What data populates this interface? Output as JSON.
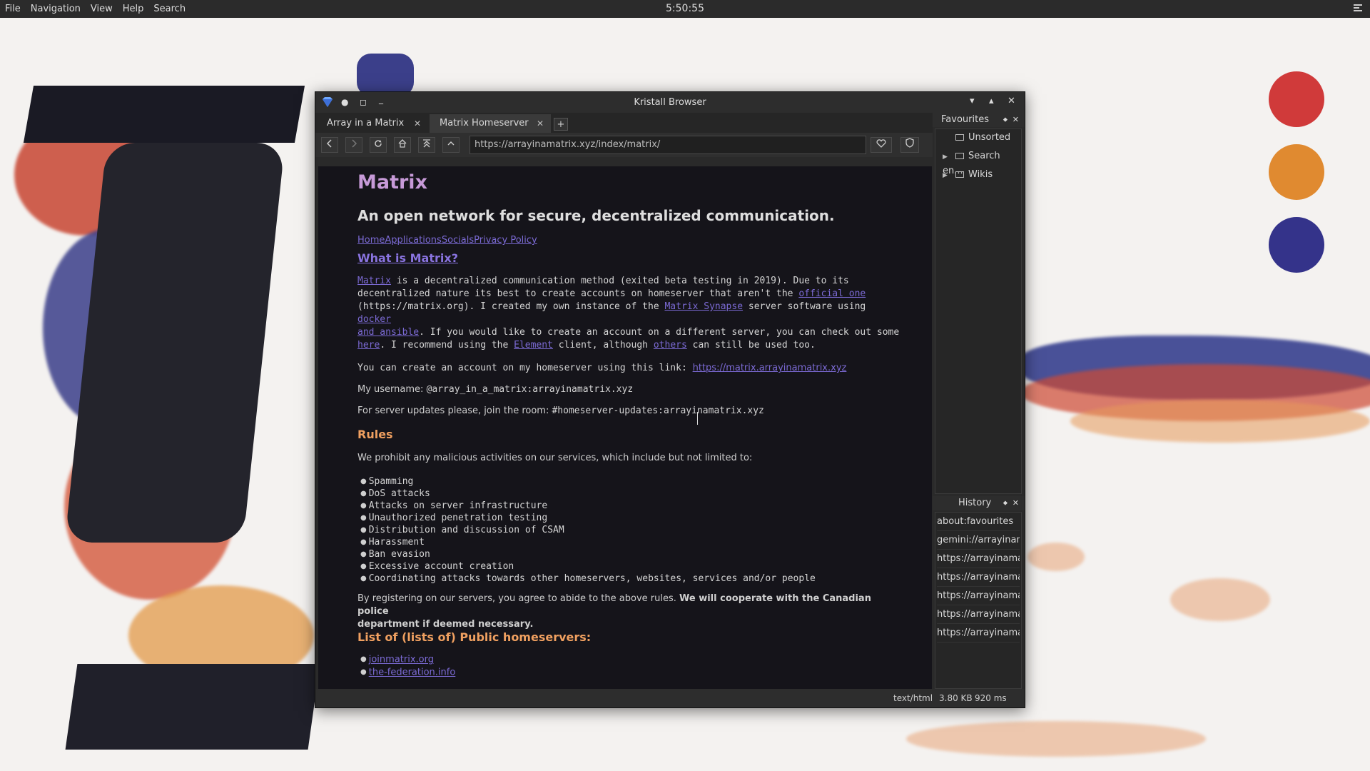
{
  "panel": {
    "menu": [
      "File",
      "Navigation",
      "View",
      "Help",
      "Search"
    ],
    "clock": "5:50:55"
  },
  "window": {
    "title": "Kristall Browser",
    "tabs": [
      {
        "label": "Array in a Matrix",
        "close": "✕"
      },
      {
        "label": "Matrix Homeserver",
        "close": "✕"
      }
    ],
    "newtab": "+",
    "url": "https://arrayinamatrix.xyz/index/matrix/"
  },
  "page": {
    "title": "Matrix",
    "subtitle": "An open network for secure, decentralized communication.",
    "nav": [
      "Home",
      "Applications",
      "Socials",
      "Privacy Policy"
    ],
    "what_heading": "What is Matrix?",
    "intro": {
      "l1a": "Matrix",
      "l1b": " is a decentralized communication method (exited beta testing in 2019). Due to its",
      "l2a": "decentralized nature its best to create accounts on homeserver that aren't the ",
      "l2b": "official one",
      "l3a": "(https://matrix.org). I created my own instance of the ",
      "l3b": "Matrix Synapse",
      "l3c": " server software using ",
      "l3d": "docker",
      "l4a": "and ansible",
      "l4b": ". If you would like to create an account on a different server, you can check out some",
      "l5a": "here",
      "l5b": ". I recommend using the ",
      "l5c": "Element",
      "l5d": " client, although ",
      "l5e": "others",
      "l5f": " can still be used too."
    },
    "account_text": "You can create an account on my homeserver using this link: ",
    "account_link": "https://matrix.arrayinamatrix.xyz",
    "username_label": "My username: ",
    "username_value": "@array_in_a_matrix:arrayinamatrix.xyz",
    "room_label": "For server updates please, join the room: ",
    "room_value": "#homeserver-updates:arrayinamatrix.xyz",
    "rules_heading": "Rules",
    "rules_intro": "We prohibit any malicious activities on our services, which include but not limited to:",
    "rules": [
      "Spamming",
      "DoS attacks",
      "Attacks on server infrastructure",
      "Unauthorized penetration testing",
      "Distribution and discussion of CSAM",
      "Harassment",
      "Ban evasion",
      "Excessive account creation",
      "Coordinating attacks towards other homeservers, websites, services and/or people"
    ],
    "agree_text": "By registering on our servers, you agree to abide to the above rules. ",
    "agree_bold_1": "We will cooperate with the Canadian police",
    "agree_bold_2": "department if deemed necessary.",
    "list_heading": "List of (lists of) Public homeservers:",
    "homeservers": [
      "joinmatrix.org",
      "the-federation.info"
    ]
  },
  "favourites": {
    "title": "Favourites",
    "items": [
      "Unsorted",
      "Search en...",
      "Wikis"
    ]
  },
  "history": {
    "title": "History",
    "items": [
      "about:favourites",
      "gemini://arrayinam",
      "https://arrayinamat",
      "https://arrayinamat",
      "https://arrayinamat",
      "https://arrayinamat",
      "https://arrayinamat"
    ]
  },
  "status": {
    "mime": "text/html",
    "size": "3.80 KB",
    "time": "920 ms"
  },
  "colors": {
    "accent_purple": "#c79ad8",
    "link": "#7b6ad4",
    "heading_orange": "#f0a060",
    "desktop_dot_red": "#d03a3a",
    "desktop_dot_orange": "#e08a30",
    "desktop_dot_blue": "#34338a"
  }
}
